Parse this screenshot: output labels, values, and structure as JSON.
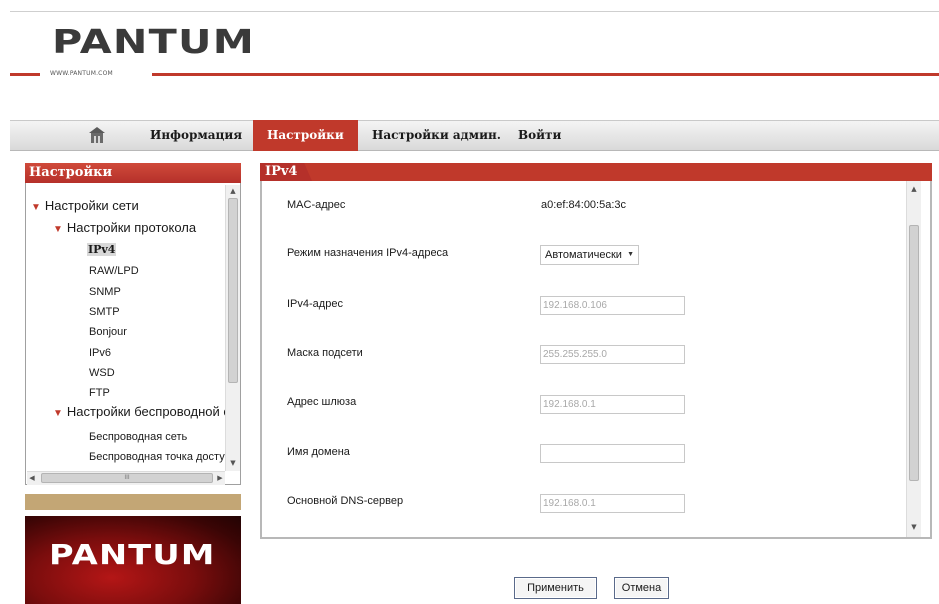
{
  "brand": {
    "logo_text": "PANTUM",
    "site_url": "WWW.PANTUM.COM"
  },
  "nav": {
    "home_icon": "home-icon",
    "items": [
      {
        "label": "Информация",
        "active": false
      },
      {
        "label": "Настройки",
        "active": true
      },
      {
        "label": "Настройки админ.",
        "active": false
      },
      {
        "label": "Войти",
        "active": false
      }
    ]
  },
  "sidebar": {
    "title": "Настройки",
    "tree": [
      {
        "label": "Настройки сети",
        "level": 0,
        "expanded": true
      },
      {
        "label": "Настройки протокола",
        "level": 1,
        "expanded": true
      },
      {
        "label": "IPv4",
        "level": 2,
        "selected": true
      },
      {
        "label": "RAW/LPD",
        "level": 2
      },
      {
        "label": "SNMP",
        "level": 2
      },
      {
        "label": "SMTP",
        "level": 2
      },
      {
        "label": "Bonjour",
        "level": 2
      },
      {
        "label": "IPv6",
        "level": 2
      },
      {
        "label": "WSD",
        "level": 2
      },
      {
        "label": "FTP",
        "level": 2
      },
      {
        "label": "Настройки беспроводной с",
        "level": 1,
        "expanded": true
      },
      {
        "label": "Беспроводная сеть",
        "level": 2
      },
      {
        "label": "Беспроводная точка досту",
        "level": 2
      }
    ],
    "hscroll_glyph": "III"
  },
  "banner": {
    "logo_text": "PANTUM"
  },
  "main": {
    "title": "IPv4",
    "fields": {
      "mac": {
        "label": "MAC-адрес",
        "value": "a0:ef:84:00:5a:3c"
      },
      "mode": {
        "label": "Режим назначения IPv4-адреса",
        "value": "Автоматически"
      },
      "ip": {
        "label": "IPv4-адрес",
        "value": "192.168.0.106"
      },
      "mask": {
        "label": "Маска подсети",
        "value": "255.255.255.0"
      },
      "gateway": {
        "label": "Адрес шлюза",
        "value": "192.168.0.1"
      },
      "domain": {
        "label": "Имя домена",
        "value": ""
      },
      "dns": {
        "label": "Основной DNS-сервер",
        "value": "192.168.0.1"
      }
    }
  },
  "buttons": {
    "apply": "Применить",
    "cancel": "Отмена"
  },
  "colors": {
    "accent": "#c0392b",
    "tan": "#c3a675"
  }
}
